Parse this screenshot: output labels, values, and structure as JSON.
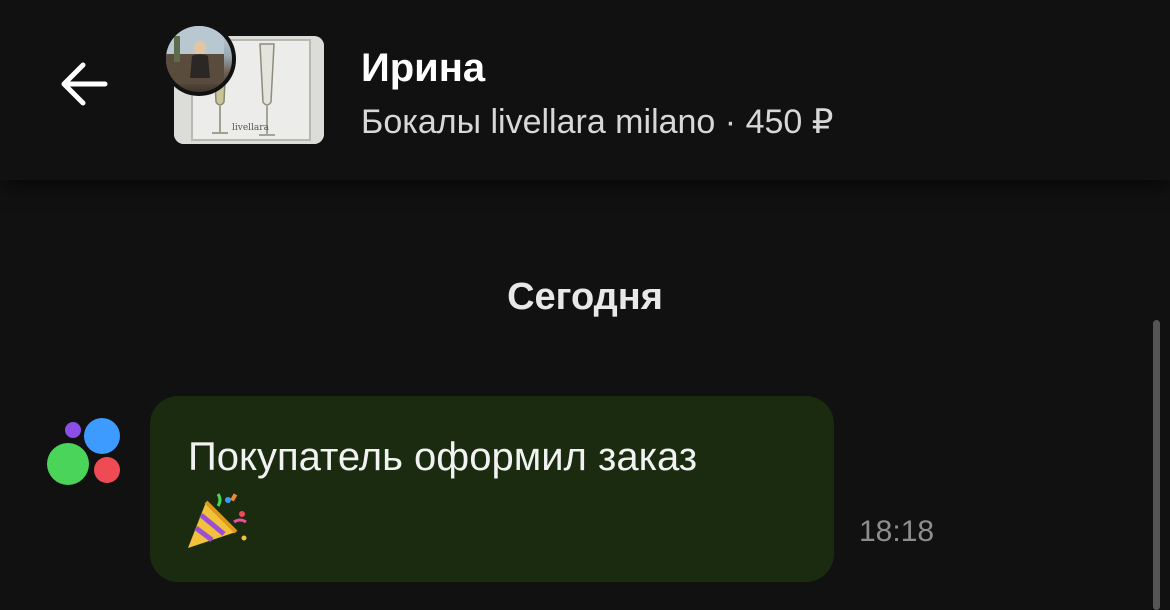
{
  "header": {
    "seller_name": "Ирина",
    "item_title": "Бокалы livellara milano",
    "separator": "·",
    "price": "450 ₽",
    "back_icon": "arrow-left-icon",
    "thumb_label": "livellara"
  },
  "chat": {
    "date_label": "Сегодня",
    "messages": [
      {
        "sender_icon": "avito-logo-icon",
        "text": "Покупатель оформил заказ",
        "emoji_icon": "party-popper-icon",
        "time": "18:18"
      }
    ]
  },
  "colors": {
    "background": "#111111",
    "bubble": "#1a2b0f",
    "logo_blue": "#3d9bff",
    "logo_green": "#4bd45a",
    "logo_red": "#ef4b55",
    "logo_purple": "#8b4fe8"
  }
}
